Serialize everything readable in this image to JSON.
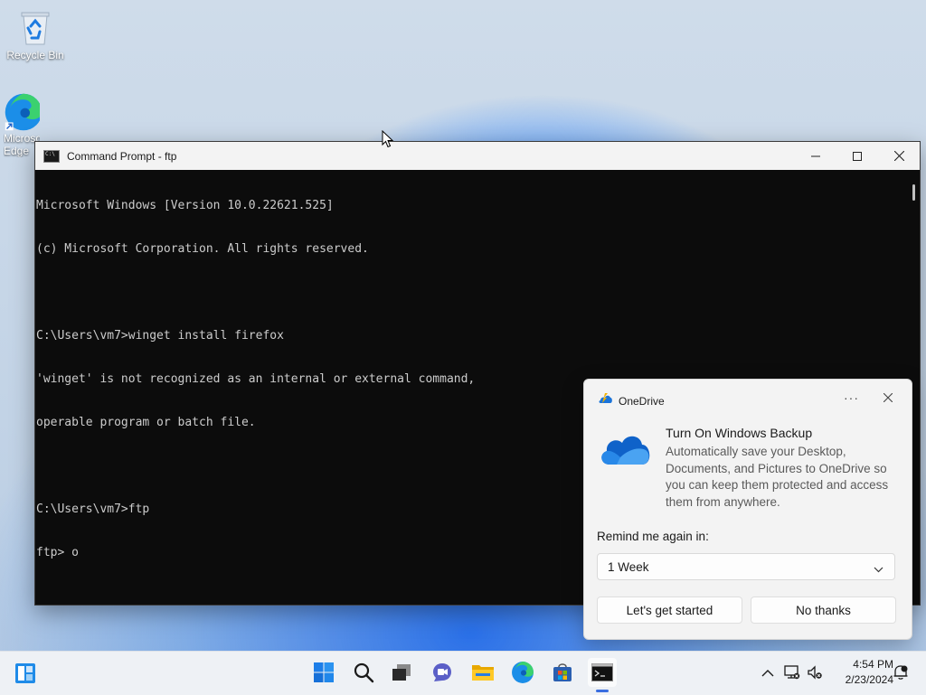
{
  "desktop": {
    "icons": [
      {
        "label": "Recycle Bin"
      },
      {
        "label": "Microsoft Edge"
      }
    ]
  },
  "cmd": {
    "title": "Command Prompt - ftp",
    "lines": [
      "Microsoft Windows [Version 10.0.22621.525]",
      "(c) Microsoft Corporation. All rights reserved.",
      "",
      "C:\\Users\\vm7>winget install firefox",
      "'winget' is not recognized as an internal or external command,",
      "operable program or batch file.",
      "",
      "C:\\Users\\vm7>ftp",
      "ftp> o"
    ]
  },
  "toast": {
    "app_name": "OneDrive",
    "more_label": "···",
    "title": "Turn On Windows Backup",
    "body": "Automatically save your Desktop, Documents, and Pictures to OneDrive so you can keep them protected and access them from anywhere.",
    "remind_label": "Remind me again in:",
    "remind_selected": "1 Week",
    "primary_button": "Let's get started",
    "secondary_button": "No thanks"
  },
  "taskbar": {
    "time": "4:54 PM",
    "date": "2/23/2024"
  },
  "colors": {
    "accent": "#0078d4",
    "cmd_bg": "#0c0c0c",
    "cmd_text": "#cccccc"
  }
}
